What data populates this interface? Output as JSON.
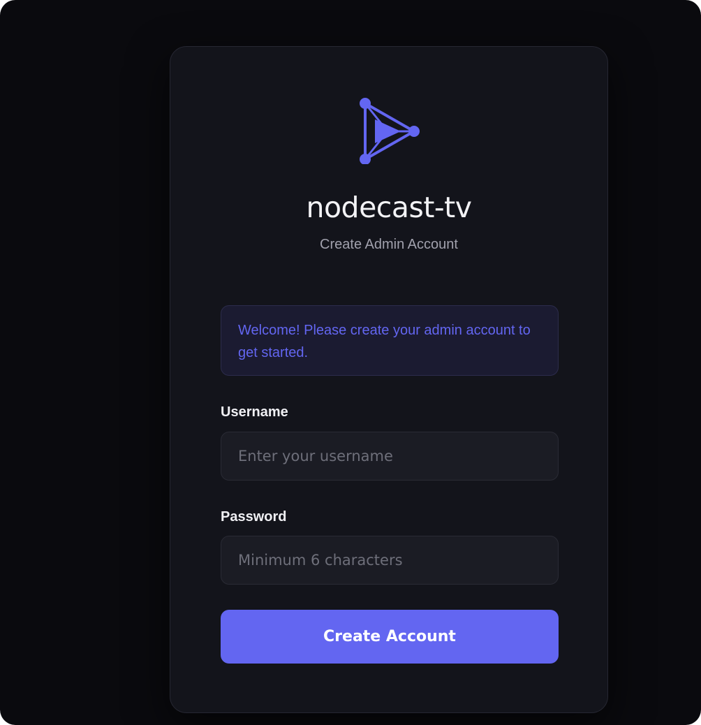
{
  "app": {
    "title": "nodecast-tv",
    "subtitle": "Create Admin Account"
  },
  "logo": {
    "icon": "node-play-icon",
    "color": "#6366f1"
  },
  "notice": {
    "text": "Welcome! Please create your admin account to get started."
  },
  "form": {
    "username": {
      "label": "Username",
      "placeholder": "Enter your username",
      "value": ""
    },
    "password": {
      "label": "Password",
      "placeholder": "Minimum 6 characters",
      "value": ""
    },
    "submit_label": "Create Account"
  },
  "colors": {
    "background": "#0a0a0e",
    "card": "#13141b",
    "accent": "#6366f1",
    "notice_bg": "#1b1b31",
    "input_bg": "#1b1c24"
  }
}
